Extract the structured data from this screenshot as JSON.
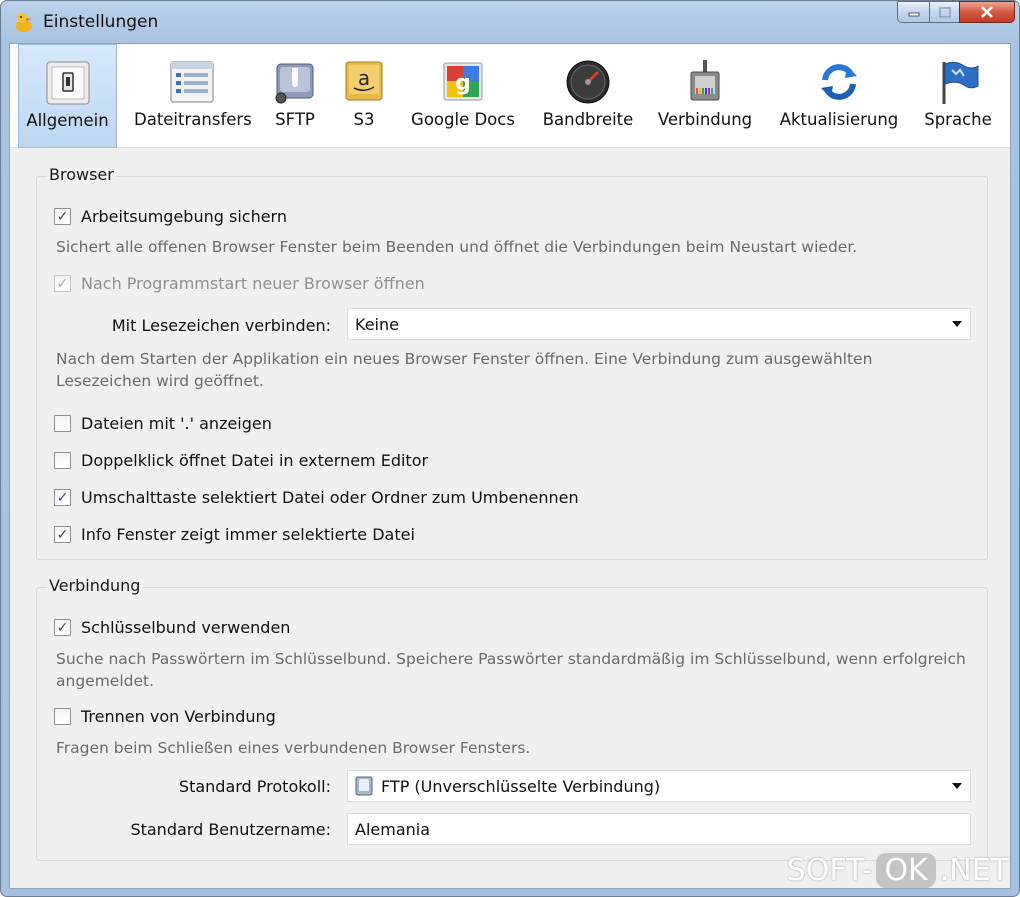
{
  "window": {
    "title": "Einstellungen",
    "accent": "#bcd2ea"
  },
  "toolbar": {
    "items": [
      {
        "label": "Allgemein",
        "icon": "switch-icon",
        "active": true
      },
      {
        "label": "Dateitransfers",
        "icon": "transfer-list-icon",
        "active": false
      },
      {
        "label": "SFTP",
        "icon": "sftp-drive-icon",
        "active": false
      },
      {
        "label": "S3",
        "icon": "s3-amazon-icon",
        "active": false
      },
      {
        "label": "Google Docs",
        "icon": "google-docs-icon",
        "active": false
      },
      {
        "label": "Bandbreite",
        "icon": "speedometer-icon",
        "active": false
      },
      {
        "label": "Verbindung",
        "icon": "network-plug-icon",
        "active": false
      },
      {
        "label": "Aktualisierung",
        "icon": "refresh-icon",
        "active": false
      },
      {
        "label": "Sprache",
        "icon": "flag-icon",
        "active": false
      }
    ]
  },
  "browser": {
    "legend": "Browser",
    "save_workspace": {
      "label": "Arbeitsumgebung sichern",
      "checked": true
    },
    "save_workspace_desc": "Sichert alle offenen Browser Fenster beim Beenden und öffnet die Verbindungen beim Neustart wieder.",
    "new_browser_on_start": {
      "label": "Nach Programmstart neuer Browser öffnen",
      "checked": true,
      "disabled": true
    },
    "bookmark_label": "Mit Lesezeichen verbinden:",
    "bookmark_value": "Keine",
    "bookmark_desc_line1": "Nach dem Starten der Applikation ein neues Browser Fenster öffnen. Eine Verbindung zum ausgewählten",
    "bookmark_desc_line2": "Lesezeichen wird geöffnet.",
    "show_hidden": {
      "label": "Dateien mit '.' anzeigen",
      "checked": false
    },
    "double_click_editor": {
      "label": "Doppelklick öffnet Datei in externem Editor",
      "checked": false
    },
    "shift_rename": {
      "label": "Umschalttaste selektiert Datei oder Ordner zum Umbenennen",
      "checked": true
    },
    "info_selected": {
      "label": "Info Fenster zeigt immer selektierte Datei",
      "checked": true
    }
  },
  "connection": {
    "legend": "Verbindung",
    "use_keychain": {
      "label": "Schlüsselbund verwenden",
      "checked": true
    },
    "keychain_desc_line1": "Suche nach Passwörtern im Schlüsselbund. Speichere Passwörter standardmäßig im Schlüsselbund, wenn erfolgreich",
    "keychain_desc_line2": "angemeldet.",
    "disconnect": {
      "label": "Trennen von Verbindung",
      "checked": false
    },
    "disconnect_desc": "Fragen beim Schließen eines verbundenen Browser Fensters.",
    "protocol_label": "Standard Protokoll:",
    "protocol_value": "FTP (Unverschlüsselte Verbindung)",
    "username_label": "Standard Benutzername:",
    "username_value": "Alemania"
  },
  "watermark": {
    "part1": "SOFT-",
    "part2": "OK",
    "part3": ".NET"
  }
}
